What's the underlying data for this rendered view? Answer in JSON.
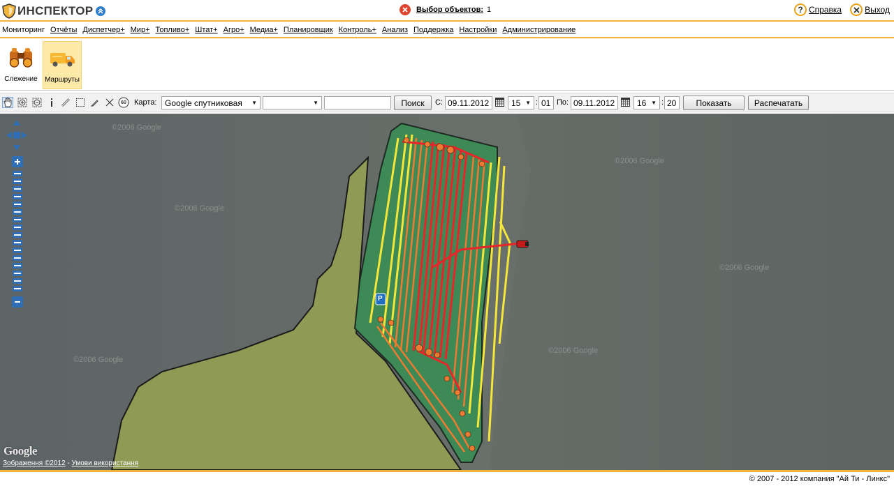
{
  "header": {
    "logo_text": "ИНСПЕКТОР",
    "selection_label": "Выбор объектов:",
    "selection_count": "1",
    "help_label": "Справка",
    "exit_label": "Выход"
  },
  "menu": {
    "items": [
      "Мониторинг",
      "Отчёты",
      "Диспетчер+",
      "Мир+",
      "Топливо+",
      "Штат+",
      "Агро+",
      "Медиа+",
      "Планировщик",
      "Контроль+",
      "Анализ",
      "Поддержка",
      "Настройки",
      "Администрирование"
    ]
  },
  "ribbon": {
    "tracking_label": "Слежение",
    "routes_label": "Маршруты"
  },
  "toolbar": {
    "map_label": "Карта:",
    "map_value": "Google спутниковая",
    "layer_value": "",
    "search_value": "",
    "search_button": "Поиск",
    "from_label": "С:",
    "from_date": "09.11.2012",
    "from_hour": "15",
    "from_minute": "01",
    "to_label": "По:",
    "to_date": "09.11.2012",
    "to_hour": "16",
    "to_minute": "20",
    "show_button": "Показать",
    "print_button": "Распечатать",
    "speed_icon_text": "60"
  },
  "map": {
    "google_logo": "Google",
    "attribution_imagery": "Зображення ©2012",
    "attribution_separator": " - ",
    "attribution_terms": "Умови використання",
    "watermark": "©2006 Google",
    "parking_marker": "P"
  },
  "footer": {
    "copyright": "© 2007 - 2012 компания \"Ай Ти - Линкс\""
  },
  "colors": {
    "accent": "#f0b43c",
    "track_red": "#e8262a",
    "track_orange": "#ef7b32",
    "track_yellow": "#f5e63a",
    "field_green": "#3e8a57",
    "polygon_olive": "#8f9a55"
  }
}
